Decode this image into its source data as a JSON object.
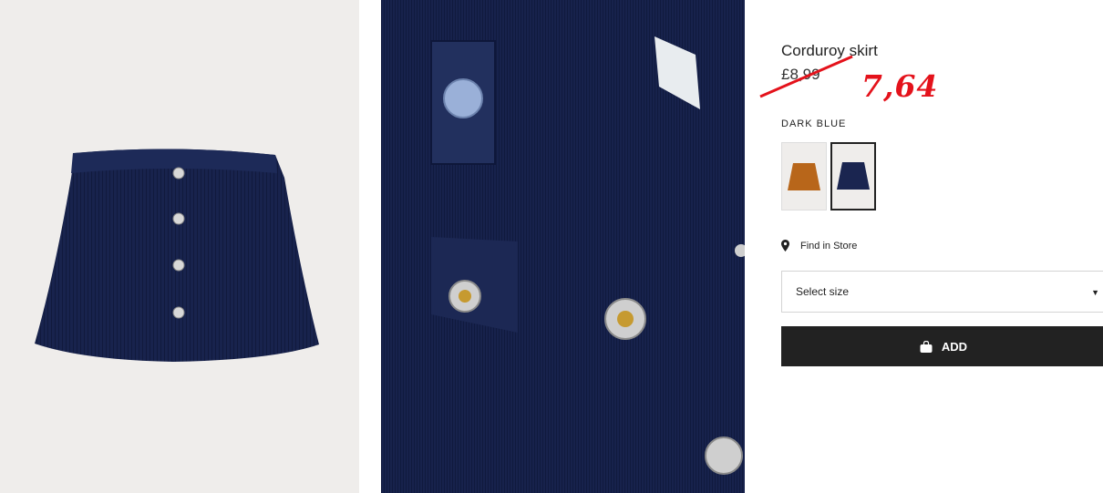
{
  "product": {
    "title": "Corduroy skirt",
    "old_price": "£8,99",
    "new_price": "7,64",
    "color_label": "DARK BLUE"
  },
  "swatches": [
    {
      "color_name": "mustard",
      "hex": "#b8661a",
      "selected": false
    },
    {
      "color_name": "dark blue",
      "hex": "#1a2550",
      "selected": true
    }
  ],
  "store": {
    "label": "Find in Store",
    "icon": "map-pin-icon"
  },
  "size_select": {
    "selected": "Select size",
    "icon": "caret-down-icon"
  },
  "add_button": {
    "label": "ADD",
    "icon": "shopping-bag-icon"
  },
  "colors": {
    "strike": "#e4121b",
    "new_price": "#e4121b",
    "button": "#222222",
    "navy": "#15214a"
  }
}
